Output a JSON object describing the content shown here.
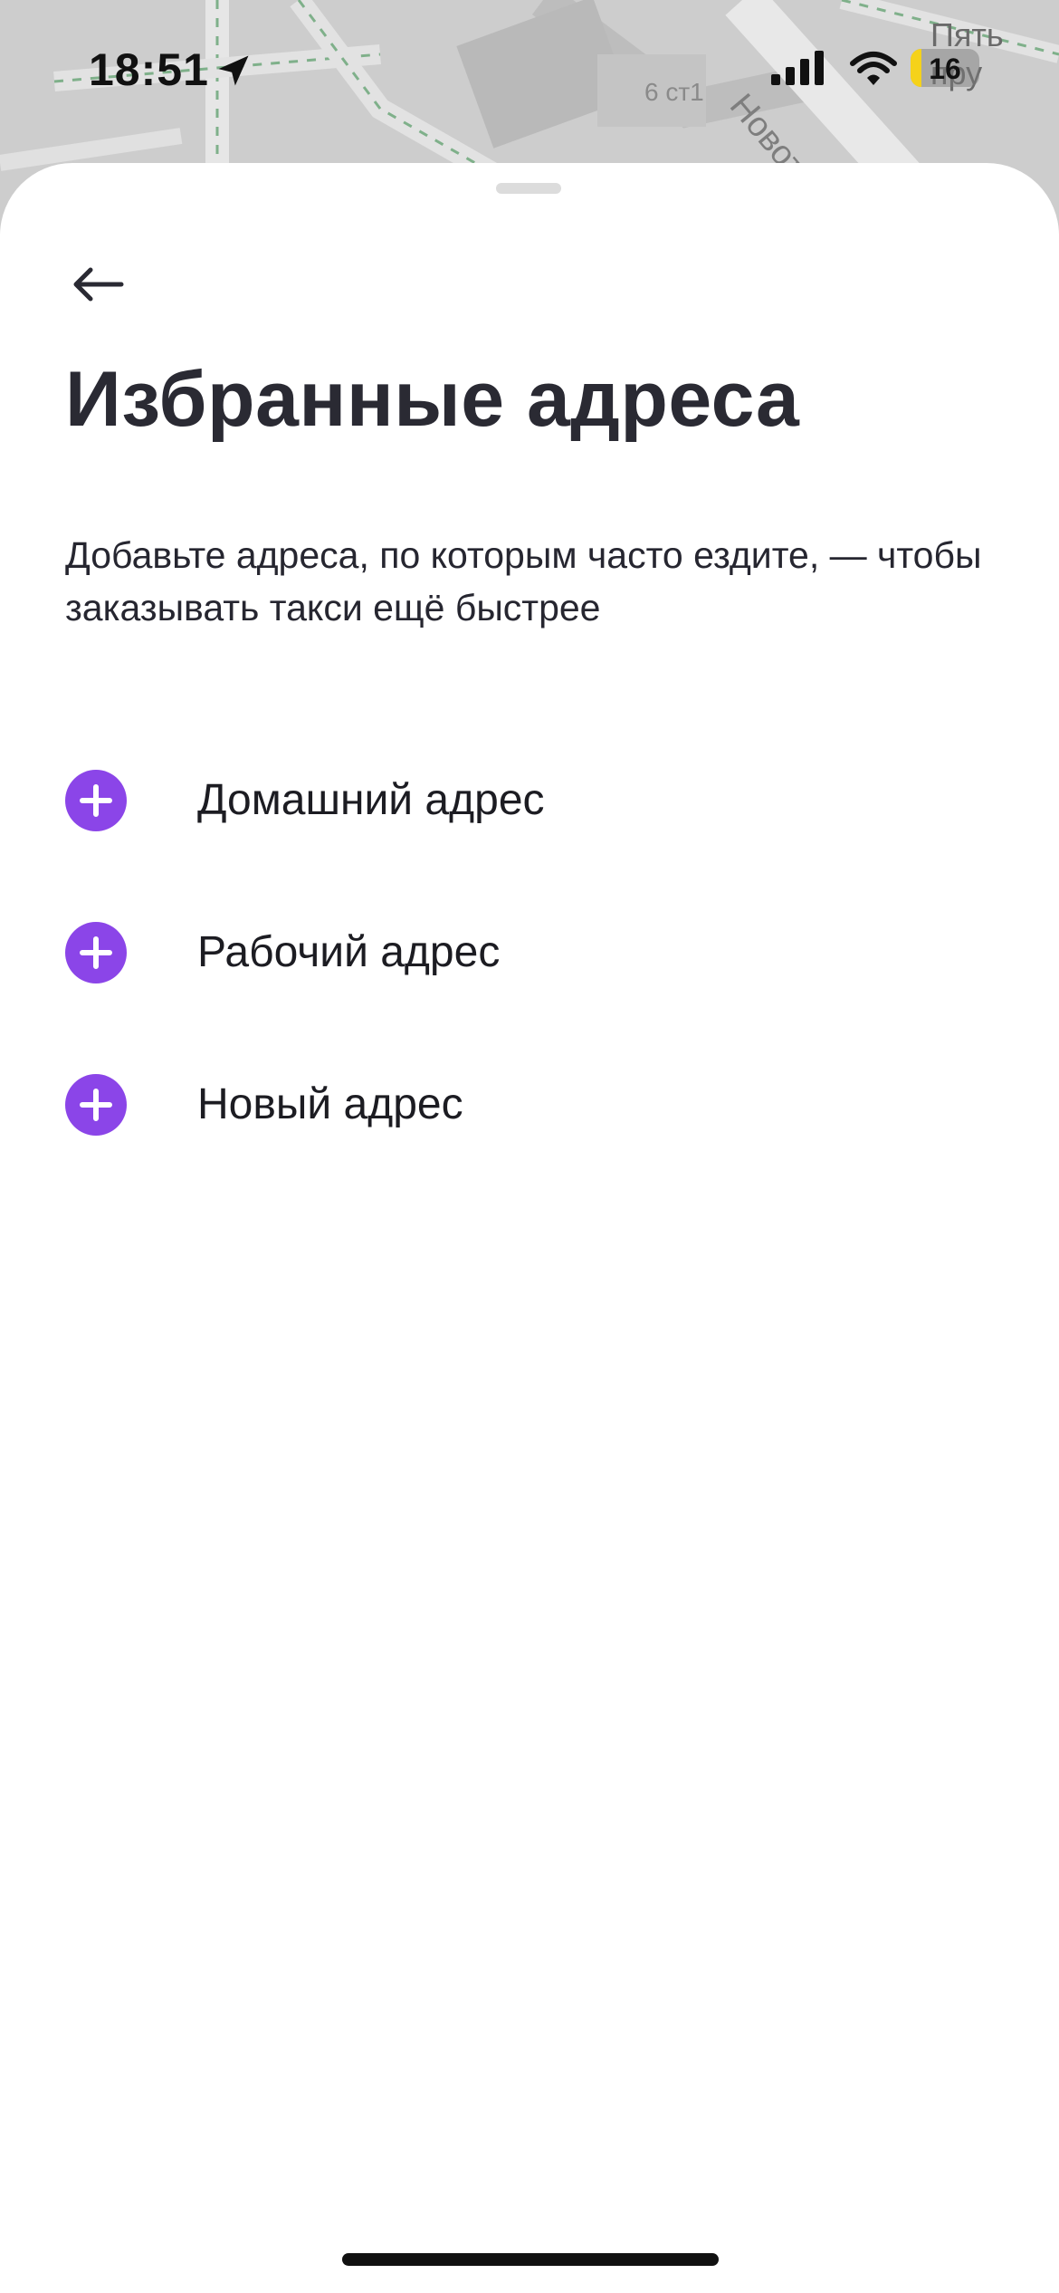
{
  "map": {
    "building_label": "6 ст1",
    "street_label": "Новоторов",
    "place_label": "Пять пру"
  },
  "status_bar": {
    "time": "18:51",
    "battery_level": "16",
    "battery_fraction": 0.16,
    "battery_color": "#f5d21a",
    "icons": [
      "location-arrow-icon",
      "signal-icon",
      "wifi-icon",
      "battery-icon"
    ]
  },
  "sheet": {
    "back_icon": "arrow-left-icon",
    "title": "Избранные адреса",
    "description": "Добавьте адреса, по которым часто ездите, — чтобы заказывать такси ещё быстрее",
    "accent_color": "#8b45e8",
    "items": [
      {
        "label": "Домашний адрес",
        "icon": "plus-icon"
      },
      {
        "label": "Рабочий адрес",
        "icon": "plus-icon"
      },
      {
        "label": "Новый адрес",
        "icon": "plus-icon"
      }
    ]
  }
}
